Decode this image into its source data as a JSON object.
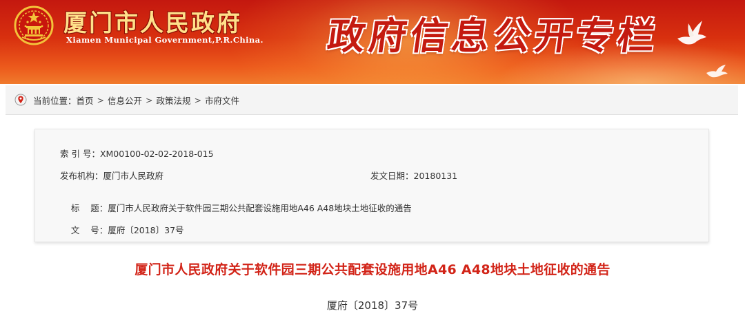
{
  "header": {
    "site_title": "厦门市人民政府",
    "site_subtitle": "Xiamen Municipal Government,P.R.China.",
    "column_title": "政府信息公开专栏",
    "emblem_icon": "national-emblem-icon",
    "dove_icon": "dove-icon"
  },
  "colors": {
    "banner_red": "#d8300f",
    "title_red": "#d22418",
    "title_gold": "#ffe08a"
  },
  "breadcrumb": {
    "icon": "location-pin-icon",
    "prefix": "当前位置：",
    "items": [
      "首页",
      "信息公开",
      "政策法规",
      "市府文件"
    ],
    "separator": ">"
  },
  "info": {
    "index_label": "索 引 号：",
    "index_value": "XM00100-02-02-2018-015",
    "publisher_label": "发布机构：",
    "publisher_value": "厦门市人民政府",
    "date_label": "发文日期：",
    "date_value": "20180131",
    "title_label": "标    题：",
    "title_value": "厦门市人民政府关于软件园三期公共配套设施用地A46 A48地块土地征收的通告",
    "docno_label": "文    号：",
    "docno_value": "厦府〔2018〕37号"
  },
  "document": {
    "title": "厦门市人民政府关于软件园三期公共配套设施用地A46 A48地块土地征收的通告",
    "number": "厦府〔2018〕37号"
  }
}
